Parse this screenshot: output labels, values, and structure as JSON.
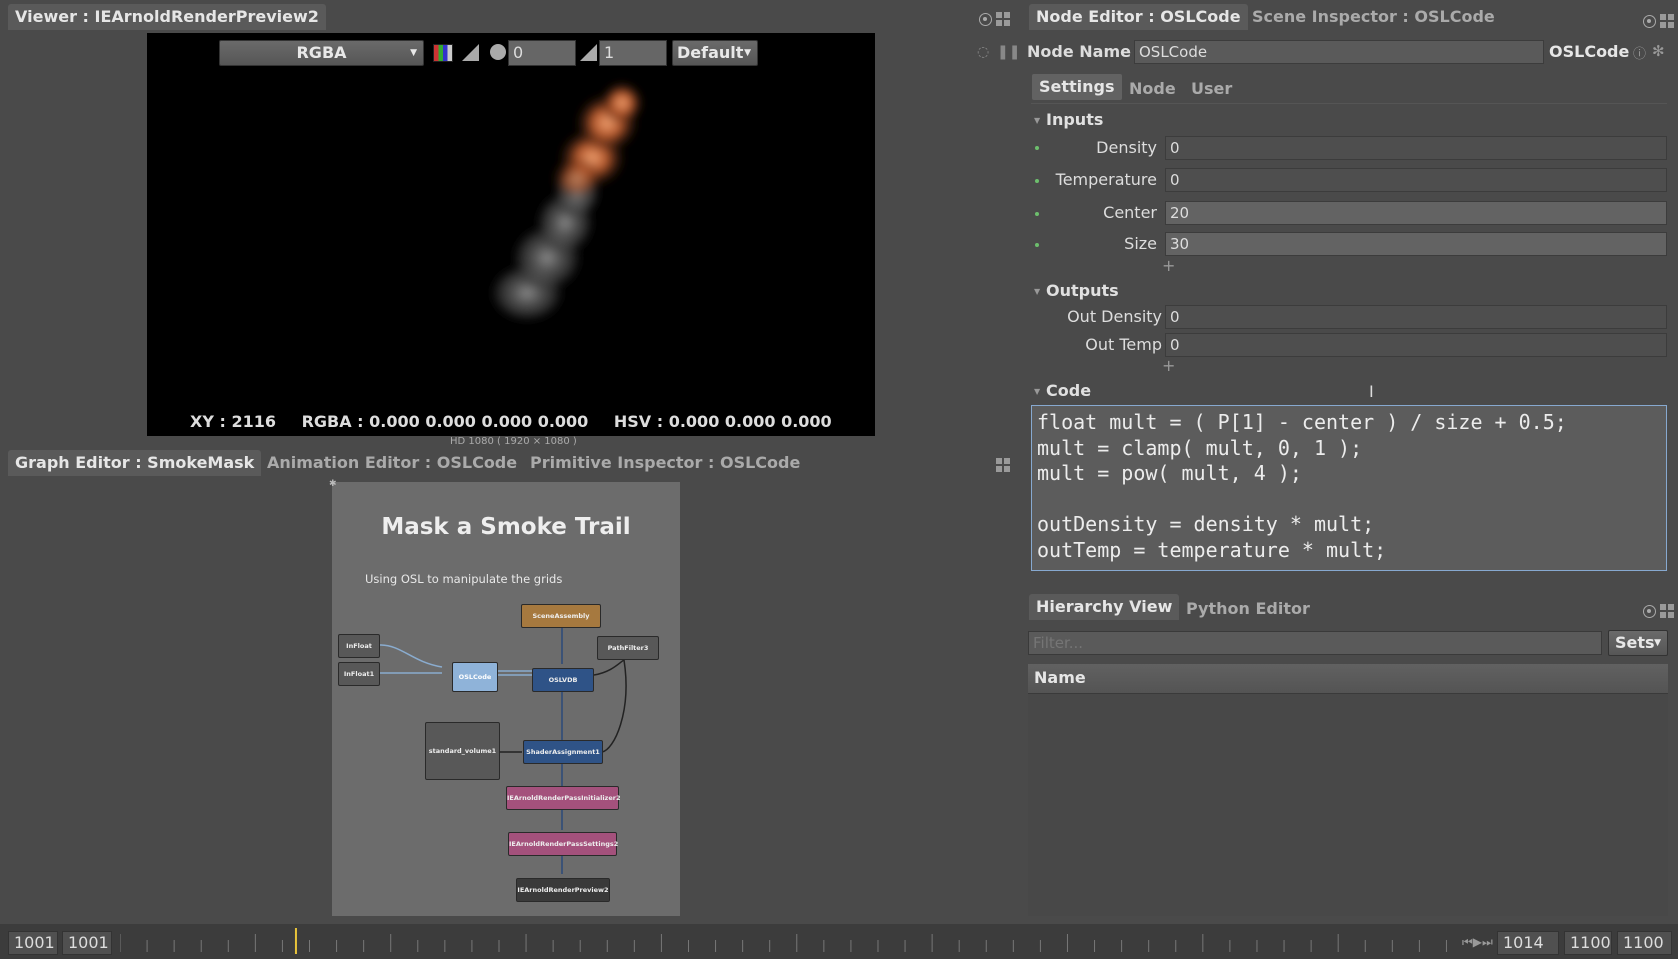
{
  "viewer": {
    "title": "Viewer : IEArnoldRenderPreview2",
    "channel": "RGBA",
    "exposure": "0",
    "gamma": "1",
    "display": "Default",
    "status_xy": "XY : 2116",
    "status_rgba": "RGBA : 0.000 0.000 0.000 0.000",
    "status_hsv": "HSV : 0.000 0.000 0.000",
    "format": "HD 1080 ( 1920 × 1080 )"
  },
  "node_editor": {
    "tabs": [
      {
        "label": "Node Editor : OSLCode"
      },
      {
        "label": "Scene Inspector : OSLCode"
      }
    ],
    "node_name_label": "Node Name",
    "node_name_value": "OSLCode",
    "node_type": "OSLCode",
    "sub_tabs": [
      {
        "label": "Settings"
      },
      {
        "label": "Node"
      },
      {
        "label": "User"
      }
    ],
    "inputs_title": "Inputs",
    "inputs": [
      {
        "label": "Density",
        "value": "0"
      },
      {
        "label": "Temperature",
        "value": "0"
      },
      {
        "label": "Center",
        "value": "20"
      },
      {
        "label": "Size",
        "value": "30"
      }
    ],
    "outputs_title": "Outputs",
    "outputs": [
      {
        "label": "Out Density",
        "value": "0"
      },
      {
        "label": "Out Temp",
        "value": "0"
      }
    ],
    "code_title": "Code",
    "code": "float mult = ( P[1] - center ) / size + 0.5;\nmult = clamp( mult, 0, 1 );\nmult = pow( mult, 4 );\n\noutDensity = density * mult;\noutTemp = temperature * mult;"
  },
  "hierarchy": {
    "tabs": [
      {
        "label": "Hierarchy View"
      },
      {
        "label": "Python Editor"
      }
    ],
    "filter_placeholder": "Filter...",
    "sets_label": "Sets",
    "column_name": "Name"
  },
  "graph": {
    "tabs": [
      {
        "label": "Graph Editor : SmokeMask"
      },
      {
        "label": "Animation Editor : OSLCode"
      },
      {
        "label": "Primitive Inspector : OSLCode"
      }
    ],
    "backdrop_title": "Mask a Smoke Trail",
    "backdrop_subtitle": "Using OSL to manipulate the grids",
    "nodes": {
      "scene_assembly": "SceneAssembly",
      "path_filter": "PathFilter3",
      "in_float": "InFloat",
      "in_float1": "InFloat1",
      "osl_code": "OSLCode",
      "oslvdb": "OSLVDB",
      "standard_volume": "standard_volume1",
      "shader_assignment": "ShaderAssignment1",
      "pass_initializer": "IEArnoldRenderPassInitializer2",
      "pass_settings": "IEArnoldRenderPassSettings2",
      "render_preview": "IEArnoldRenderPreview2"
    },
    "node_colors": {
      "scene": "#a6793f",
      "osl_code": "#8fb3d9",
      "blue": "#2f5387",
      "pink": "#a4517c",
      "grey": "#585858",
      "dark": "#3a3a3a"
    }
  },
  "timeline": {
    "start_a": "1001",
    "start_b": "1001",
    "current": "1014",
    "end_a": "1100",
    "end_b": "1100",
    "current_frame": 1014,
    "range_start": 1001,
    "range_end": 1100
  }
}
